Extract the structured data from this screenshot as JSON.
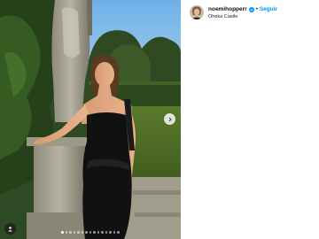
{
  "post": {
    "username": "noemihopperr",
    "follow_label": "Seguir",
    "separator": "•",
    "location": "Oheka Castle",
    "slide_count": 15,
    "active_slide": 1
  },
  "icons": {
    "verified": "verified-badge-icon",
    "next": "chevron-right-icon",
    "tag": "user-tag-icon"
  },
  "colors": {
    "follow": "#0095f6",
    "verified": "#0095f6"
  }
}
